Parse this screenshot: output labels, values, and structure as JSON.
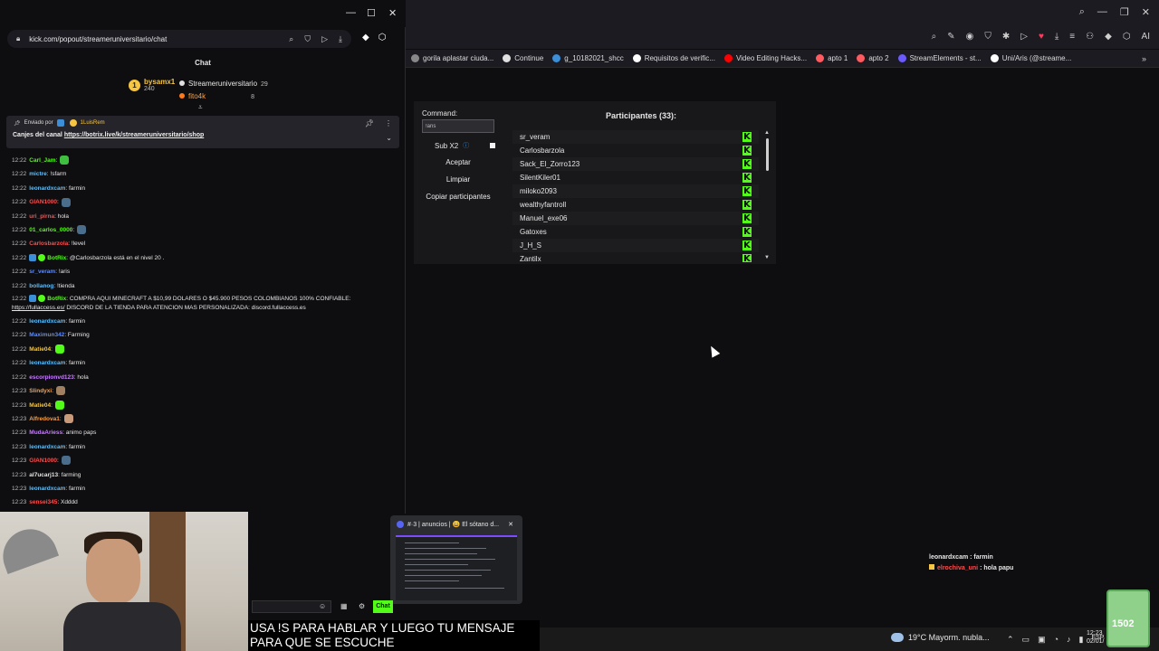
{
  "main_browser": {
    "bookmarks": [
      {
        "label": "gorila aplastar ciuda...",
        "color": "#888888"
      },
      {
        "label": "Continue",
        "color": "#e0e0e0"
      },
      {
        "label": "g_10182021_shcc",
        "color": "#3b8fd9"
      },
      {
        "label": "Requisitos de verific...",
        "color": "#ffffff"
      },
      {
        "label": "Video Editing Hacks...",
        "color": "#ff0000"
      },
      {
        "label": "apto 1",
        "color": "#ff5a5f"
      },
      {
        "label": "apto 2",
        "color": "#ff5a5f"
      },
      {
        "label": "StreamElements - st...",
        "color": "#6b5bff"
      },
      {
        "label": "Uni/Aris (@streame...",
        "color": "#ffffff"
      }
    ]
  },
  "bot_panel": {
    "command_label": "Command:",
    "command_value": "!aris",
    "sub_label": "Sub X2",
    "accept_label": "Aceptar",
    "clear_label": "Limpiar",
    "copy_label": "Copiar participantes",
    "participants_title": "Participantes (33):",
    "participants": [
      "sr_veram",
      "Carlosbarzola",
      "Sack_El_Zorro123",
      "SilentKiler01",
      "miloko2093",
      "wealthyfantroll",
      "Manuel_exe06",
      "Gatoxes",
      "J_H_S",
      "Zantilx"
    ],
    "badge": "K"
  },
  "popout": {
    "url": "kick.com/popout/streameruniversitario/chat",
    "chat_header": "Chat",
    "leaderboard": {
      "top_name": "bysamx1",
      "top_points": "240",
      "top_rank": "1",
      "second_name": "Streameruniversitario",
      "second_count": "29",
      "third_name": "fito4k",
      "third_count": "8"
    },
    "pinned": {
      "sent_by": "Enviado por",
      "sender": "1LuisRem",
      "text": "Canjes del canal",
      "link": "https://botrix.live/k/streameruniversitario/shop"
    },
    "messages": [
      {
        "ts": "12:22",
        "user": "Carl_Jam",
        "color": "#53fc18",
        "text": ":",
        "emote": "#3fbf3f"
      },
      {
        "ts": "12:22",
        "user": "mictre",
        "color": "#5bc0ff",
        "text": ": !sfarm"
      },
      {
        "ts": "12:22",
        "user": "leonardxcam",
        "color": "#5bc0ff",
        "text": ": farmin"
      },
      {
        "ts": "12:22",
        "user": "GIAN1000",
        "color": "#ff4d4d",
        "text": ":",
        "emote": "#4a6d8c"
      },
      {
        "ts": "12:22",
        "user": "uri_pirna",
        "color": "#ff4d4d",
        "text": ": hola"
      },
      {
        "ts": "12:22",
        "user": "01_carlos_0000",
        "color": "#53fc18",
        "text": ":",
        "emote": "#4a6d8c"
      },
      {
        "ts": "12:22",
        "user": "Carlosbarzola",
        "color": "#ff4d4d",
        "text": ": !level"
      },
      {
        "ts": "12:22",
        "user": "BotRix",
        "color": "#53fc18",
        "text": ": @Carlosbarzola está en el nivel 20 ."
      },
      {
        "ts": "12:22",
        "user": "sr_veram",
        "color": "#5b8cff",
        "text": ": !aris"
      },
      {
        "ts": "12:22",
        "user": "bollanog",
        "color": "#5bc0ff",
        "text": ": !tienda"
      },
      {
        "ts": "12:22",
        "user": "BotRix",
        "color": "#53fc18",
        "text": ": COMPRA AQUI MINECRAFT A $10,99 DOLARES O $45.900 PESOS COLOMBIANOS 100% CONFIABLE:",
        "link": "https://fullaccess.es/",
        "text2": " DISCORD DE LA TIENDA PARA ATENCION MAS PERSONALIZADA: discord.fullaccess.es"
      },
      {
        "ts": "12:22",
        "user": "leonardxcam",
        "color": "#5bc0ff",
        "text": ": farmin"
      },
      {
        "ts": "12:22",
        "user": "Maximun342",
        "color": "#5b8cff",
        "text": ": Farming"
      },
      {
        "ts": "12:22",
        "user": "Matie04",
        "color": "#f6c542",
        "text": ":",
        "emote": "#53fc18"
      },
      {
        "ts": "12:22",
        "user": "leonardxcam",
        "color": "#5bc0ff",
        "text": ": farmin"
      },
      {
        "ts": "12:22",
        "user": "escorpionvd123",
        "color": "#c77dff",
        "text": ": hola"
      },
      {
        "ts": "12:23",
        "user": "Slindyxi",
        "color": "#ff9f40",
        "text": ":",
        "emote": "#a08060"
      },
      {
        "ts": "12:23",
        "user": "Matie04",
        "color": "#f6c542",
        "text": ":",
        "emote": "#53fc18"
      },
      {
        "ts": "12:23",
        "user": "Alfredova1",
        "color": "#ff9f40",
        "text": ":",
        "emote": "#c89a7a"
      },
      {
        "ts": "12:23",
        "user": "MudaAriess",
        "color": "#c77dff",
        "text": ": animo paps"
      },
      {
        "ts": "12:23",
        "user": "leonardxcam",
        "color": "#5bc0ff",
        "text": ": farmin"
      },
      {
        "ts": "12:23",
        "user": "GIAN1000",
        "color": "#ff4d4d",
        "text": ":",
        "emote": "#4a6d8c"
      },
      {
        "ts": "12:23",
        "user": "al7ucarj13",
        "color": "#e6e6e6",
        "text": ": farming"
      },
      {
        "ts": "12:23",
        "user": "leonardxcam",
        "color": "#5bc0ff",
        "text": ": farmin"
      },
      {
        "ts": "12:23",
        "user": "sensei345",
        "color": "#ff4d4d",
        "text": ": Xdddd"
      }
    ],
    "send_label": "Chat"
  },
  "overlay_chat": [
    {
      "user": "leonardxcam",
      "color": "#e6e6e6",
      "text": " : farmin"
    },
    {
      "user": "elrochiva_uni",
      "color": "#ff4d4d",
      "text": " : hola papu"
    }
  ],
  "discord_preview": {
    "title": "#·3 | anuncios | 😀 El sótano d..."
  },
  "caption": "USA !S PARA HABLAR Y LUEGO TU MENSAJE PARA QUE SE ESCUCHE",
  "taskbar": {
    "weather": "19°C  Mayorm. nubla...",
    "language": "ESP",
    "time": "12:23",
    "date": "02/01/"
  },
  "mug_label": "1502"
}
